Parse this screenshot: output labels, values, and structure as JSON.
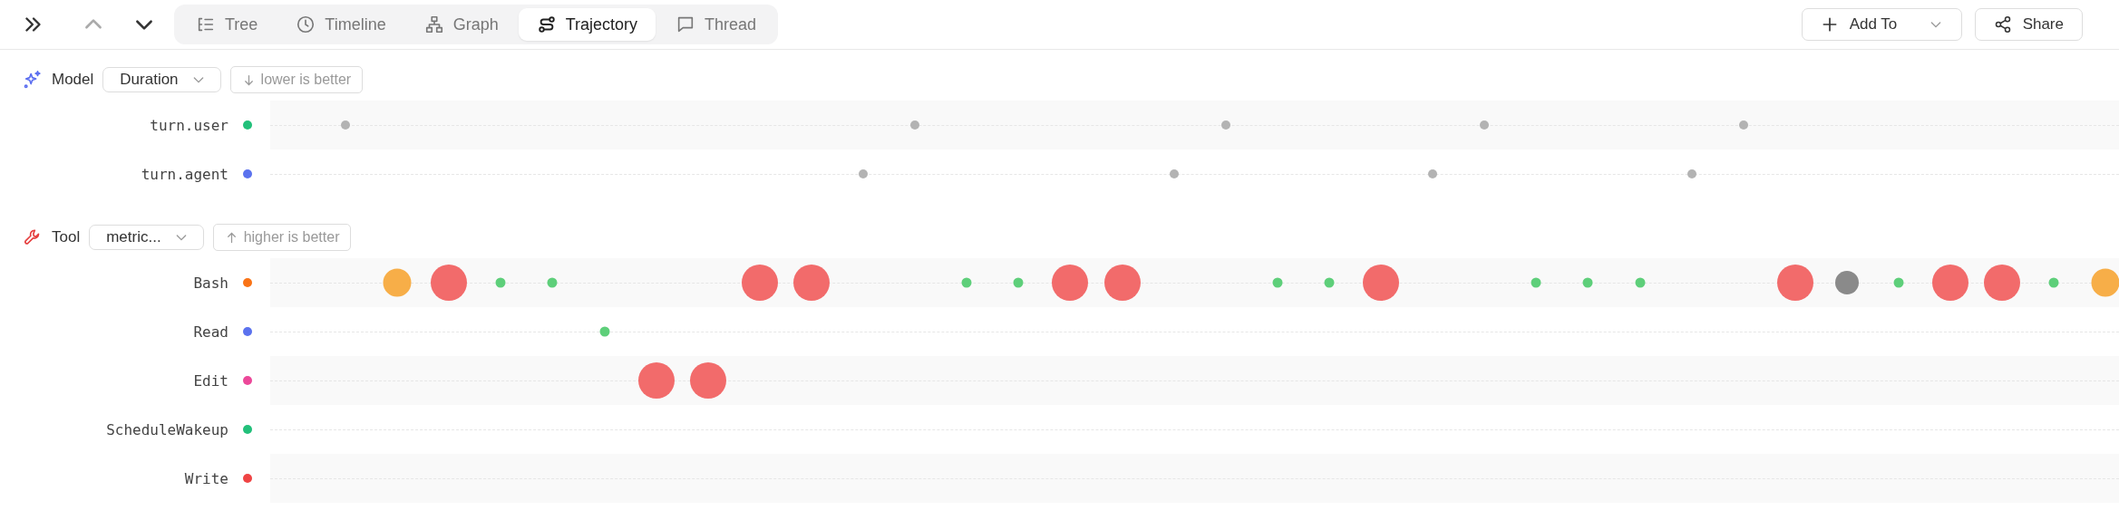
{
  "toolbar": {
    "tabs": [
      {
        "label": "Tree",
        "selected": false
      },
      {
        "label": "Timeline",
        "selected": false
      },
      {
        "label": "Graph",
        "selected": false
      },
      {
        "label": "Trajectory",
        "selected": true
      },
      {
        "label": "Thread",
        "selected": false
      }
    ],
    "prev_disabled": true,
    "next_disabled": false,
    "add_to": "Add To",
    "share": "Share"
  },
  "sections": [
    {
      "kind": "model",
      "title": "Model",
      "metric": "Duration",
      "hint": {
        "kind": "down",
        "text": "lower is better"
      },
      "lanes": [
        {
          "name": "turn.user",
          "color": "#22c07a",
          "marks": [
            {
              "kind": "turn"
            },
            {
              "kind": "none"
            },
            {
              "kind": "none"
            },
            {
              "kind": "none"
            },
            {
              "kind": "none"
            },
            {
              "kind": "none"
            },
            {
              "kind": "none"
            },
            {
              "kind": "none"
            },
            {
              "kind": "none"
            },
            {
              "kind": "none"
            },
            {
              "kind": "none"
            },
            {
              "kind": "turn"
            },
            {
              "kind": "none"
            },
            {
              "kind": "none"
            },
            {
              "kind": "none"
            },
            {
              "kind": "none"
            },
            {
              "kind": "none"
            },
            {
              "kind": "turn"
            },
            {
              "kind": "none"
            },
            {
              "kind": "none"
            },
            {
              "kind": "none"
            },
            {
              "kind": "none"
            },
            {
              "kind": "turn"
            },
            {
              "kind": "none"
            },
            {
              "kind": "none"
            },
            {
              "kind": "none"
            },
            {
              "kind": "none"
            },
            {
              "kind": "turn"
            }
          ]
        },
        {
          "name": "turn.agent",
          "color": "#5b72ee",
          "marks": [
            {
              "kind": "none"
            },
            {
              "kind": "none"
            },
            {
              "kind": "none"
            },
            {
              "kind": "none"
            },
            {
              "kind": "none"
            },
            {
              "kind": "none"
            },
            {
              "kind": "none"
            },
            {
              "kind": "none"
            },
            {
              "kind": "none"
            },
            {
              "kind": "none"
            },
            {
              "kind": "turn"
            },
            {
              "kind": "none"
            },
            {
              "kind": "none"
            },
            {
              "kind": "none"
            },
            {
              "kind": "none"
            },
            {
              "kind": "none"
            },
            {
              "kind": "turn"
            },
            {
              "kind": "none"
            },
            {
              "kind": "none"
            },
            {
              "kind": "none"
            },
            {
              "kind": "none"
            },
            {
              "kind": "turn"
            },
            {
              "kind": "none"
            },
            {
              "kind": "none"
            },
            {
              "kind": "none"
            },
            {
              "kind": "none"
            },
            {
              "kind": "turn"
            }
          ]
        }
      ]
    },
    {
      "kind": "tool",
      "title": "Tool",
      "metric": "metric...",
      "hint": {
        "kind": "up",
        "text": "higher is better"
      },
      "lanes": [
        {
          "name": "Bash",
          "color": "#f97316",
          "marks": [
            {
              "kind": "none"
            },
            {
              "kind": "warn"
            },
            {
              "kind": "fail"
            },
            {
              "kind": "pass"
            },
            {
              "kind": "pass"
            },
            {
              "kind": "none"
            },
            {
              "kind": "none"
            },
            {
              "kind": "none"
            },
            {
              "kind": "fail"
            },
            {
              "kind": "fail"
            },
            {
              "kind": "none"
            },
            {
              "kind": "none"
            },
            {
              "kind": "pass"
            },
            {
              "kind": "pass"
            },
            {
              "kind": "fail"
            },
            {
              "kind": "fail"
            },
            {
              "kind": "none"
            },
            {
              "kind": "none"
            },
            {
              "kind": "pass"
            },
            {
              "kind": "pass"
            },
            {
              "kind": "fail"
            },
            {
              "kind": "none"
            },
            {
              "kind": "none"
            },
            {
              "kind": "pass"
            },
            {
              "kind": "pass"
            },
            {
              "kind": "pass"
            },
            {
              "kind": "none"
            },
            {
              "kind": "none"
            },
            {
              "kind": "fail"
            },
            {
              "kind": "neutral"
            },
            {
              "kind": "pass"
            },
            {
              "kind": "fail"
            },
            {
              "kind": "fail"
            },
            {
              "kind": "pass"
            },
            {
              "kind": "warn"
            }
          ]
        },
        {
          "name": "Read",
          "color": "#5b72ee",
          "marks": [
            {
              "kind": "none"
            },
            {
              "kind": "none"
            },
            {
              "kind": "none"
            },
            {
              "kind": "none"
            },
            {
              "kind": "none"
            },
            {
              "kind": "pass"
            }
          ]
        },
        {
          "name": "Edit",
          "color": "#ec4899",
          "marks": [
            {
              "kind": "none"
            },
            {
              "kind": "none"
            },
            {
              "kind": "none"
            },
            {
              "kind": "none"
            },
            {
              "kind": "none"
            },
            {
              "kind": "none"
            },
            {
              "kind": "fail"
            },
            {
              "kind": "fail"
            }
          ]
        },
        {
          "name": "ScheduleWakeup",
          "color": "#22c07a"
        },
        {
          "name": "Write",
          "color": "#ef4444"
        }
      ]
    }
  ]
}
